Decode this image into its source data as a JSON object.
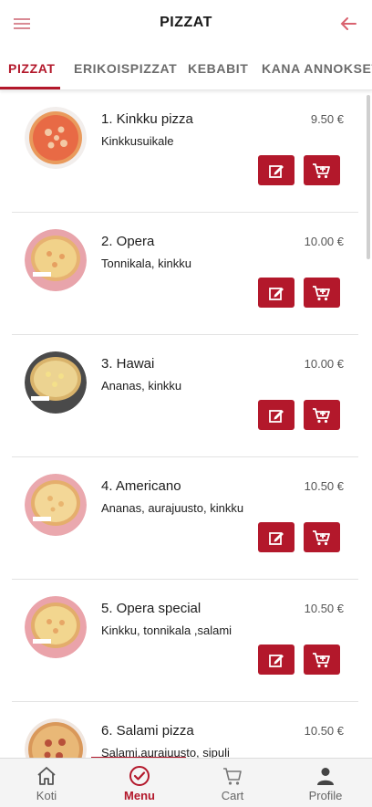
{
  "header": {
    "title": "PIZZAT",
    "menu_icon": "hamburger-icon",
    "back_icon": "arrow-left-icon"
  },
  "tabs": [
    {
      "label": "PIZZAT",
      "active": true
    },
    {
      "label": "ERIKOISPIZZAT",
      "active": false
    },
    {
      "label": "KEBABIT",
      "active": false
    },
    {
      "label": "KANA ANNOKSET",
      "active": false
    }
  ],
  "items": [
    {
      "name": "1. Kinkku pizza",
      "desc": "Kinkkusuikale",
      "price": "9.50 €"
    },
    {
      "name": "2. Opera",
      "desc": "Tonnikala, kinkku",
      "price": "10.00 €"
    },
    {
      "name": "3. Hawai",
      "desc": "Ananas, kinkku",
      "price": "10.00 €"
    },
    {
      "name": "4. Americano",
      "desc": "Ananas, aurajuusto, kinkku",
      "price": "10.50 €"
    },
    {
      "name": "5. Opera special",
      "desc": "Kinkku, tonnikala ,salami",
      "price": "10.50 €"
    },
    {
      "name": "6. Salami pizza",
      "desc": "Salami,aurajuusto, sipuli",
      "price": "10.50 €"
    }
  ],
  "nav": [
    {
      "label": "Koti",
      "icon": "home-icon",
      "active": false
    },
    {
      "label": "Menu",
      "icon": "check-circle-icon",
      "active": true
    },
    {
      "label": "Cart",
      "icon": "cart-icon",
      "active": false
    },
    {
      "label": "Profile",
      "icon": "user-icon",
      "active": false
    }
  ],
  "colors": {
    "accent": "#b3182b",
    "nav_bg": "#f4f4f4"
  }
}
